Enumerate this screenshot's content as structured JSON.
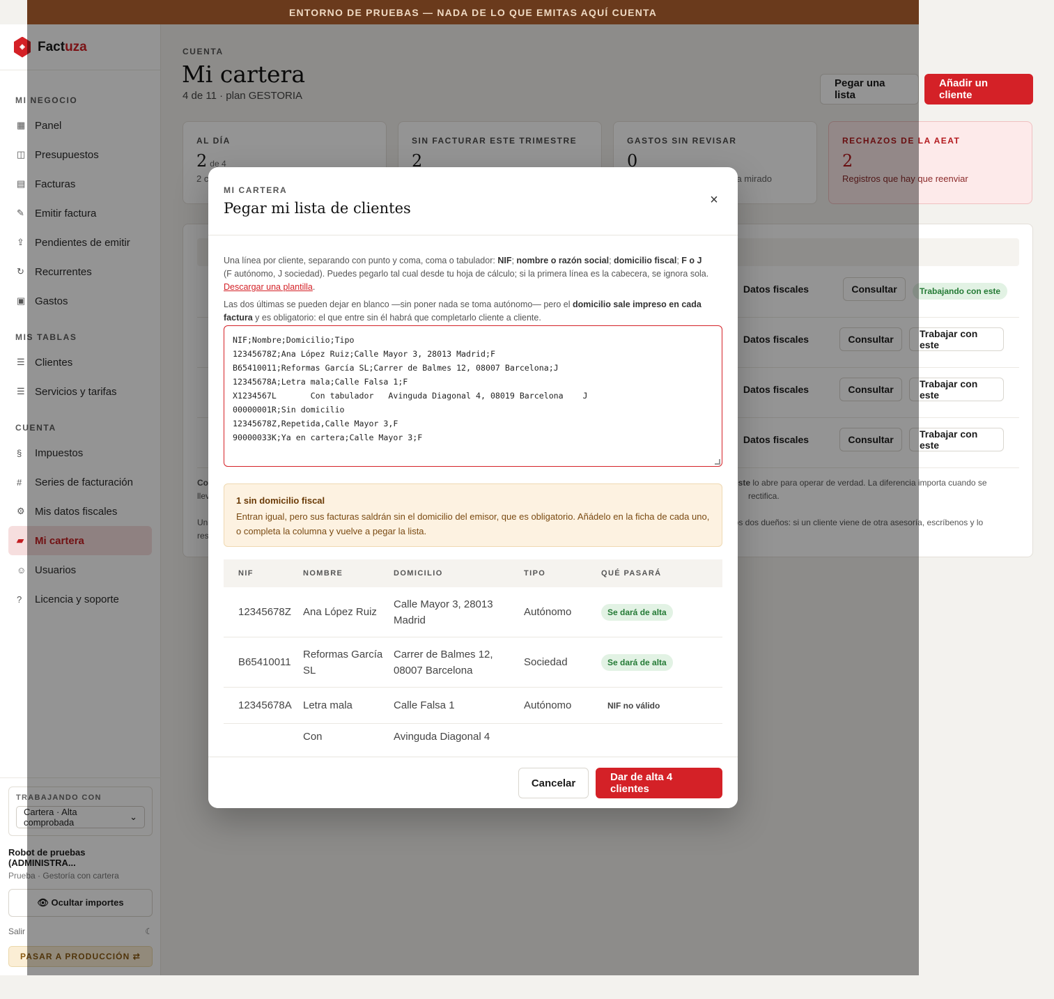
{
  "banner": "ENTORNO DE PRUEBAS — NADA DE LO QUE EMITAS AQUÍ CUENTA",
  "brand": {
    "name_start": "Fact",
    "name_end": "uza",
    "accent_color": "#d42127"
  },
  "sidebar": {
    "sections": [
      {
        "title": "MI NEGOCIO",
        "items": [
          {
            "label": "Panel",
            "icon": "▦"
          },
          {
            "label": "Presupuestos",
            "icon": "◫"
          },
          {
            "label": "Facturas",
            "icon": "▤"
          },
          {
            "label": "Emitir factura",
            "icon": "✎"
          },
          {
            "label": "Pendientes de emitir",
            "icon": "⇪"
          },
          {
            "label": "Recurrentes",
            "icon": "↻"
          },
          {
            "label": "Gastos",
            "icon": "▣"
          }
        ]
      },
      {
        "title": "MIS TABLAS",
        "items": [
          {
            "label": "Clientes",
            "icon": "☰"
          },
          {
            "label": "Servicios y tarifas",
            "icon": "☰"
          }
        ]
      },
      {
        "title": "CUENTA",
        "items": [
          {
            "label": "Impuestos",
            "icon": "§"
          },
          {
            "label": "Series de facturación",
            "icon": "#"
          },
          {
            "label": "Mis datos fiscales",
            "icon": "⚙"
          },
          {
            "label": "Mi cartera",
            "icon": "▰",
            "active": true
          },
          {
            "label": "Usuarios",
            "icon": "☺"
          },
          {
            "label": "Licencia y soporte",
            "icon": "?"
          }
        ]
      }
    ],
    "working_with_label": "TRABAJANDO CON",
    "working_with_value": "Cartera · Alta comprobada",
    "user_name": "Robot de pruebas (ADMINISTRA...",
    "user_sub": "Prueba · Gestoría con cartera",
    "hide_amounts": "👁 Ocultar importes",
    "logout": "Salir",
    "theme_icon": "☾",
    "production_button": "PASAR A PRODUCCIÓN ⇄"
  },
  "page": {
    "eyebrow": "CUENTA",
    "title": "Mi cartera",
    "subtitle": "4 de 11 · plan GESTORIA",
    "paste_button": "Pegar una lista",
    "add_button": "Añadir un cliente"
  },
  "cards": [
    {
      "label": "AL DÍA",
      "value": "2",
      "value_suffix": "de 4",
      "sub": "2 c"
    },
    {
      "label": "SIN FACTURAR ESTE TRIMESTRE",
      "value": "2",
      "value_suffix": "",
      "sub": ""
    },
    {
      "label": "GASTOS SIN REVISAR",
      "value": "0",
      "value_suffix": "",
      "sub": "los ha mirado"
    },
    {
      "label": "RECHAZOS DE LA AEAT",
      "value": "2",
      "value_suffix": "",
      "sub": "Registros que hay que reenviar"
    }
  ],
  "background_rows": [
    {
      "fiscal": "Datos fiscales",
      "consult": "Consultar",
      "status": "Trabajando con este",
      "status_type": "pill"
    },
    {
      "fiscal": "Datos fiscales",
      "consult": "Consultar",
      "status": "Trabajar con este",
      "status_type": "button"
    },
    {
      "fiscal": "Datos fiscales",
      "consult": "Consultar",
      "status": "Trabajar con este",
      "status_type": "button"
    },
    {
      "fiscal": "Datos fiscales",
      "consult": "Consultar",
      "status": "Trabajar con este",
      "status_type": "button"
    }
  ],
  "background_notes": {
    "n1a": "Co",
    "n1b_bold": "on este",
    "n1c": " lo abre para operar de verdad. La diferencia importa cuando se",
    "n1d": "llev",
    "n1e": "rectifica.",
    "n2a": "Un",
    "n2b": "tos dos dueños: si un cliente viene de otra asesoría, escríbenos y lo",
    "n2c": "res"
  },
  "modal": {
    "eyebrow": "MI CARTERA",
    "title": "Pegar mi lista de clientes",
    "close": "×",
    "intro_1": "Una línea por cliente, separando con punto y coma, coma o tabulador: ",
    "intro_b1": "NIF",
    "intro_2": "; ",
    "intro_b2": "nombre o razón social",
    "intro_3": "; ",
    "intro_b3": "domicilio fiscal",
    "intro_4": "; ",
    "intro_b4": "F o J",
    "intro_5": " (F autónomo, J sociedad). Puedes pegarlo tal cual desde tu hoja de cálculo; si la primera línea es la cabecera, se ignora sola.",
    "template_link": "Descargar una plantilla",
    "intro_6": ".",
    "note_1": "Las dos últimas se pueden dejar en blanco —sin poner nada se toma autónomo— pero el ",
    "note_b": "domicilio sale impreso en cada factura",
    "note_2": " y es obligatorio: el que entre sin él habrá que completarlo cliente a cliente.",
    "textarea": "NIF;Nombre;Domicilio;Tipo\n12345678Z;Ana López Ruiz;Calle Mayor 3, 28013 Madrid;F\nB65410011;Reformas García SL;Carrer de Balmes 12, 08007 Barcelona;J\n12345678A;Letra mala;Calle Falsa 1;F\nX1234567L       Con tabulador   Avinguda Diagonal 4, 08019 Barcelona    J\n00000001R;Sin domicilio\n12345678Z,Repetida,Calle Mayor 3,F\n90000033K;Ya en cartera;Calle Mayor 3;F",
    "warning_title": "1 sin domicilio fiscal",
    "warning_text": "Entran igual, pero sus facturas saldrán sin el domicilio del emisor, que es obligatorio. Añádelo en la ficha de cada uno, o completa la columna y vuelve a pegar la lista.",
    "preview_headers": [
      "NIF",
      "NOMBRE",
      "DOMICILIO",
      "TIPO",
      "QUÉ PASARÁ"
    ],
    "preview_rows": [
      {
        "nif": "12345678Z",
        "name": "Ana López Ruiz",
        "address": "Calle Mayor 3, 28013 Madrid",
        "type": "Autónomo",
        "result": "Se dará de alta",
        "result_kind": "ok"
      },
      {
        "nif": "B65410011",
        "name": "Reformas García SL",
        "address": "Carrer de Balmes 12, 08007 Barcelona",
        "type": "Sociedad",
        "result": "Se dará de alta",
        "result_kind": "ok"
      },
      {
        "nif": "12345678A",
        "name": "Letra mala",
        "address": "Calle Falsa 1",
        "type": "Autónomo",
        "result": "NIF no válido",
        "result_kind": "bad"
      },
      {
        "nif": "",
        "name": "Con",
        "address": "Avinguda Diagonal 4",
        "type": "",
        "result": "",
        "result_kind": ""
      }
    ],
    "cancel": "Cancelar",
    "submit": "Dar de alta 4 clientes"
  }
}
